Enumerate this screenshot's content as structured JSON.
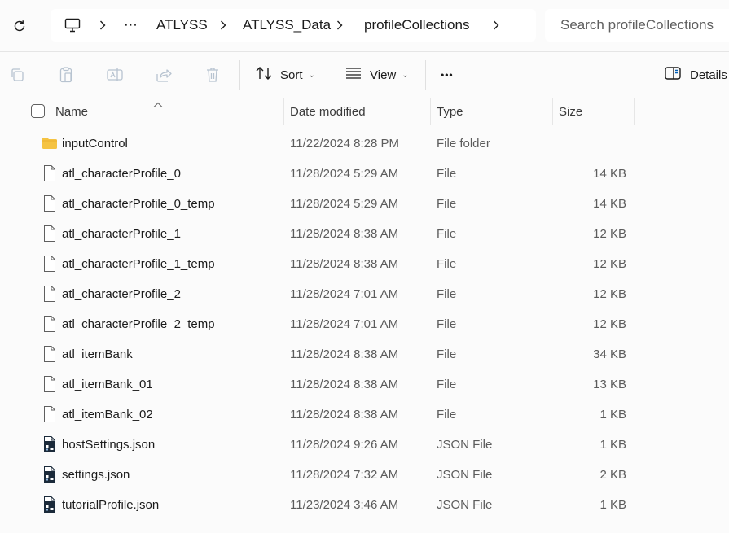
{
  "address": {
    "more": "⋯",
    "crumbs": [
      "ATLYSS",
      "ATLYSS_Data",
      "profileCollections"
    ]
  },
  "search": {
    "placeholder": "Search profileCollections"
  },
  "toolbar": {
    "sort_label": "Sort",
    "view_label": "View",
    "more_label": "•••",
    "details_label": "Details"
  },
  "columns": {
    "name": "Name",
    "date": "Date modified",
    "type": "Type",
    "size": "Size"
  },
  "files": [
    {
      "name": "inputControl",
      "date": "11/22/2024 8:28 PM",
      "type": "File folder",
      "size": "",
      "icon": "folder-icon"
    },
    {
      "name": "atl_characterProfile_0",
      "date": "11/28/2024 5:29 AM",
      "type": "File",
      "size": "14 KB",
      "icon": "file-icon"
    },
    {
      "name": "atl_characterProfile_0_temp",
      "date": "11/28/2024 5:29 AM",
      "type": "File",
      "size": "14 KB",
      "icon": "file-icon"
    },
    {
      "name": "atl_characterProfile_1",
      "date": "11/28/2024 8:38 AM",
      "type": "File",
      "size": "12 KB",
      "icon": "file-icon"
    },
    {
      "name": "atl_characterProfile_1_temp",
      "date": "11/28/2024 8:38 AM",
      "type": "File",
      "size": "12 KB",
      "icon": "file-icon"
    },
    {
      "name": "atl_characterProfile_2",
      "date": "11/28/2024 7:01 AM",
      "type": "File",
      "size": "12 KB",
      "icon": "file-icon"
    },
    {
      "name": "atl_characterProfile_2_temp",
      "date": "11/28/2024 7:01 AM",
      "type": "File",
      "size": "12 KB",
      "icon": "file-icon"
    },
    {
      "name": "atl_itemBank",
      "date": "11/28/2024 8:38 AM",
      "type": "File",
      "size": "34 KB",
      "icon": "file-icon"
    },
    {
      "name": "atl_itemBank_01",
      "date": "11/28/2024 8:38 AM",
      "type": "File",
      "size": "13 KB",
      "icon": "file-icon"
    },
    {
      "name": "atl_itemBank_02",
      "date": "11/28/2024 8:38 AM",
      "type": "File",
      "size": "1 KB",
      "icon": "file-icon"
    },
    {
      "name": "hostSettings.json",
      "date": "11/28/2024 9:26 AM",
      "type": "JSON File",
      "size": "1 KB",
      "icon": "json-file-icon"
    },
    {
      "name": "settings.json",
      "date": "11/28/2024 7:32 AM",
      "type": "JSON File",
      "size": "2 KB",
      "icon": "json-file-icon"
    },
    {
      "name": "tutorialProfile.json",
      "date": "11/23/2024 3:46 AM",
      "type": "JSON File",
      "size": "1 KB",
      "icon": "json-file-icon"
    }
  ],
  "colors": {
    "folder": "#f5c342",
    "background": "#fbfbfb",
    "accent": "#005fb8"
  }
}
